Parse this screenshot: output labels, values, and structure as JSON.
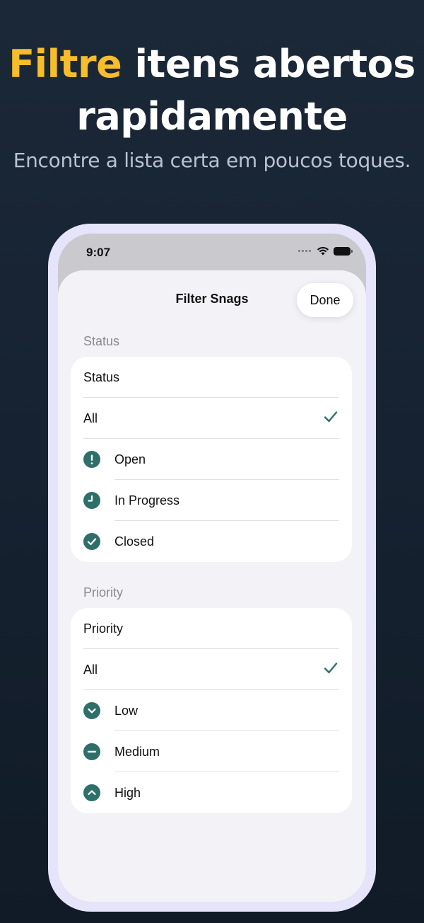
{
  "headline": {
    "accent": "Filtre",
    "rest": " itens abertos rapidamente"
  },
  "subheadline": "Encontre a lista certa em poucos toques.",
  "status_bar": {
    "time": "9:07"
  },
  "sheet": {
    "title": "Filter Snags",
    "done_label": "Done"
  },
  "status_section": {
    "header": "Status",
    "picker_label": "Status",
    "options": [
      {
        "label": "All",
        "selected": true,
        "icon": ""
      },
      {
        "label": "Open",
        "selected": false,
        "icon": "exclamation-circle-icon"
      },
      {
        "label": "In Progress",
        "selected": false,
        "icon": "clock-icon"
      },
      {
        "label": "Closed",
        "selected": false,
        "icon": "checkmark-circle-icon"
      }
    ]
  },
  "priority_section": {
    "header": "Priority",
    "picker_label": "Priority",
    "options": [
      {
        "label": "All",
        "selected": true,
        "icon": ""
      },
      {
        "label": "Low",
        "selected": false,
        "icon": "chevron-down-circle-icon"
      },
      {
        "label": "Medium",
        "selected": false,
        "icon": "minus-circle-icon"
      },
      {
        "label": "High",
        "selected": false,
        "icon": "chevron-up-circle-icon"
      }
    ]
  },
  "colors": {
    "accent": "#f7bd2a",
    "icon_teal": "#2f6f6a",
    "background": "#162231",
    "device_frame": "#e6e4fb"
  }
}
